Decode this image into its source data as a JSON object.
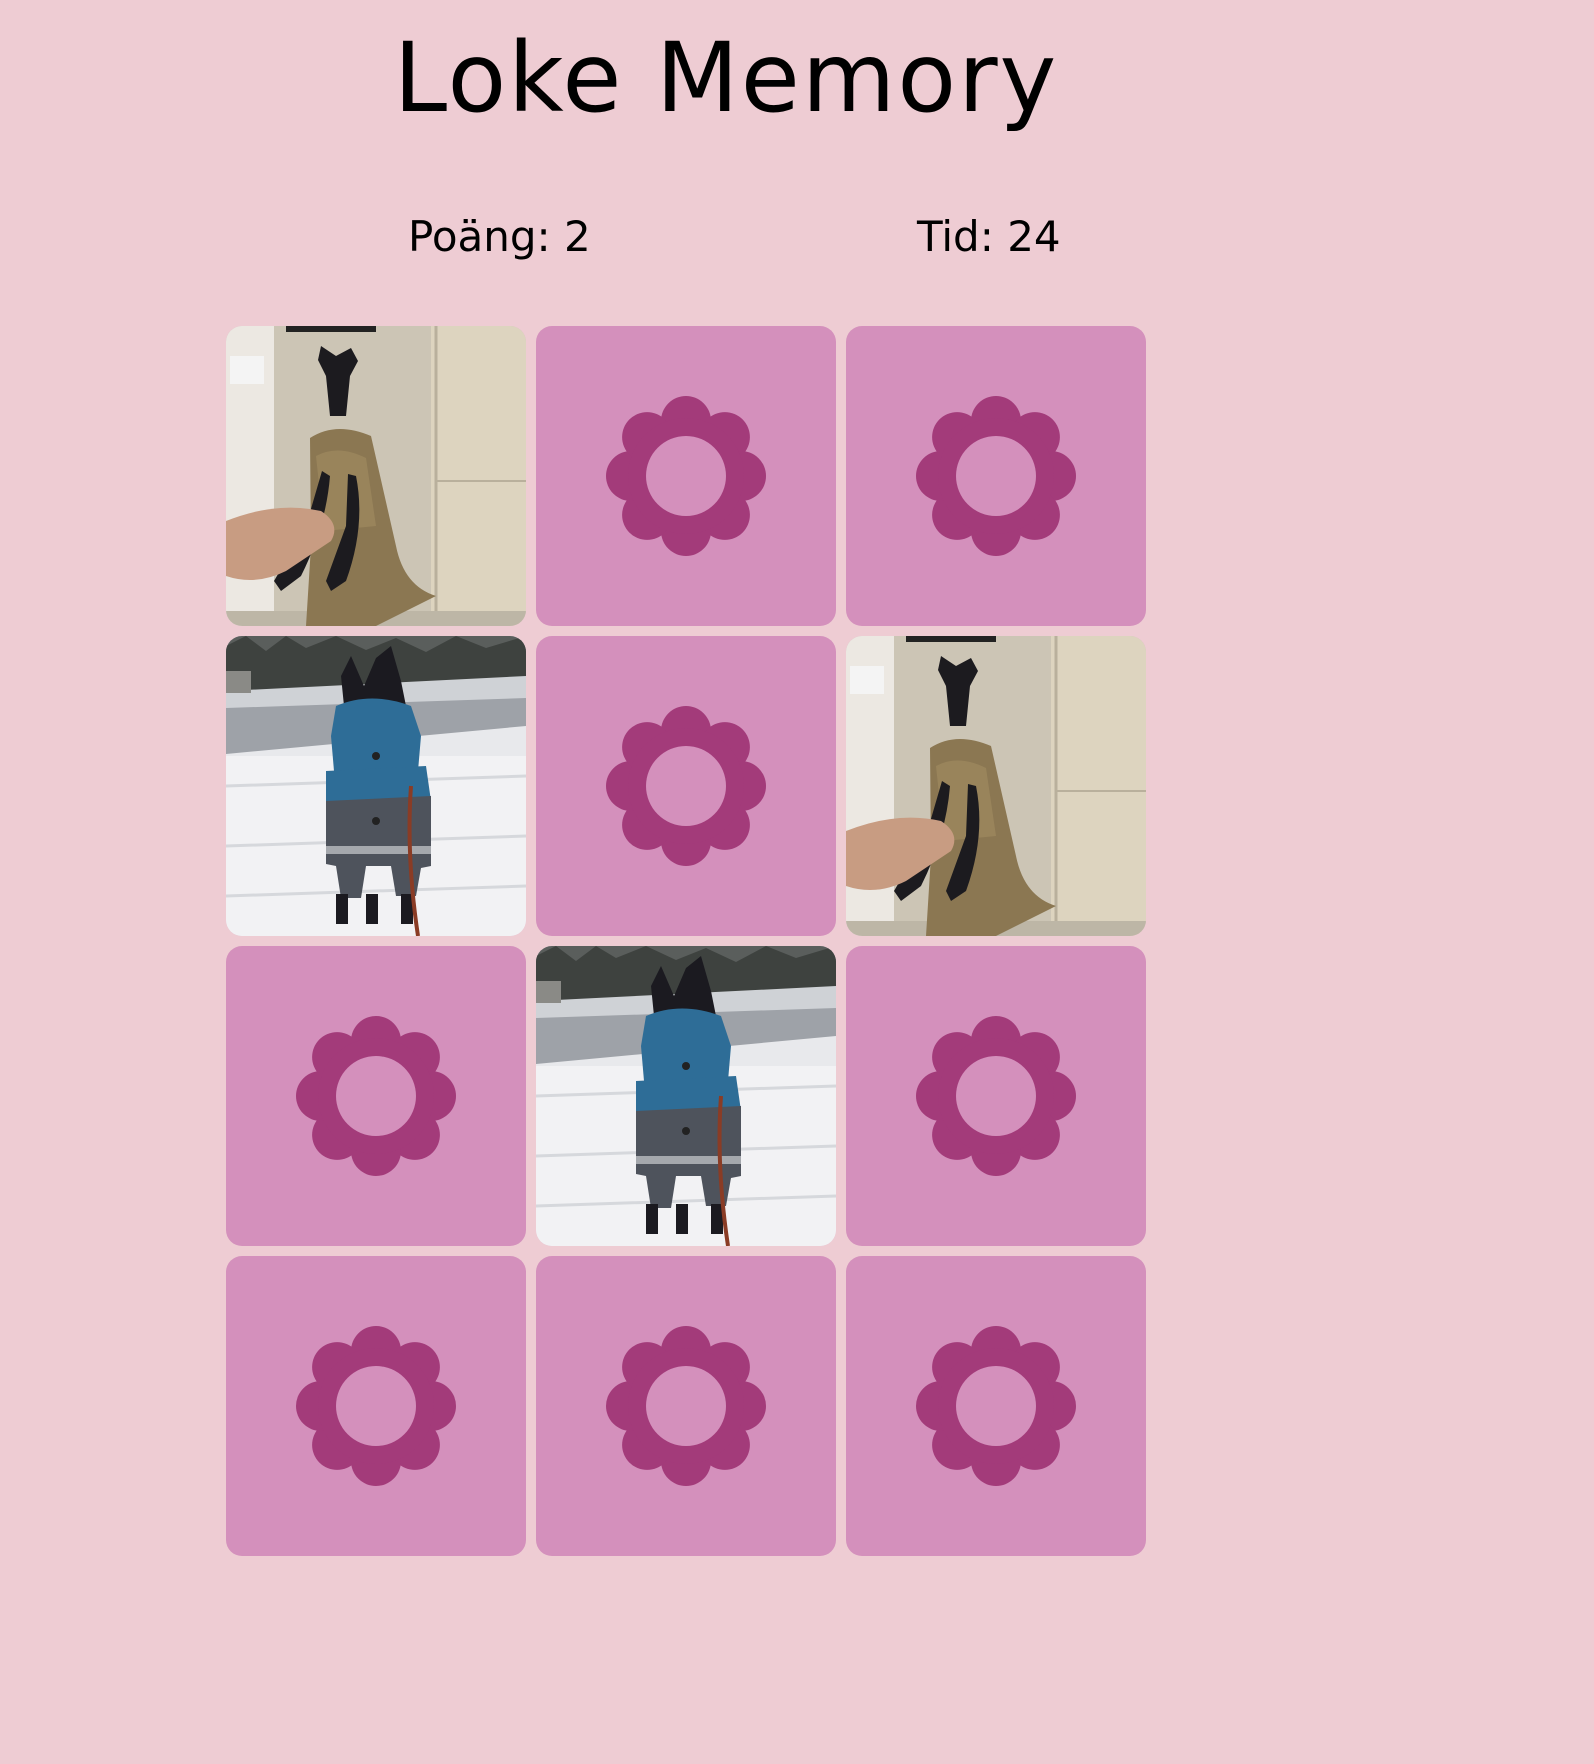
{
  "game": {
    "title": "Loke Memory",
    "score_text": "Poäng: 2",
    "time_text": "Tid: 24"
  },
  "colors": {
    "background": "#eeccd3",
    "card_back": "#d490bc",
    "flower": "#a33b7a"
  },
  "cards": [
    {
      "state": "face-up",
      "image": "dog-in-burlap-sack"
    },
    {
      "state": "face-down",
      "icon": "flower-icon"
    },
    {
      "state": "face-down",
      "icon": "flower-icon"
    },
    {
      "state": "face-up",
      "image": "dog-in-blue-jacket-snow"
    },
    {
      "state": "face-down",
      "icon": "flower-icon"
    },
    {
      "state": "face-up",
      "image": "dog-in-burlap-sack"
    },
    {
      "state": "face-down",
      "icon": "flower-icon"
    },
    {
      "state": "face-up",
      "image": "dog-in-blue-jacket-snow"
    },
    {
      "state": "face-down",
      "icon": "flower-icon"
    },
    {
      "state": "face-down",
      "icon": "flower-icon"
    },
    {
      "state": "face-down",
      "icon": "flower-icon"
    },
    {
      "state": "face-down",
      "icon": "flower-icon"
    }
  ]
}
